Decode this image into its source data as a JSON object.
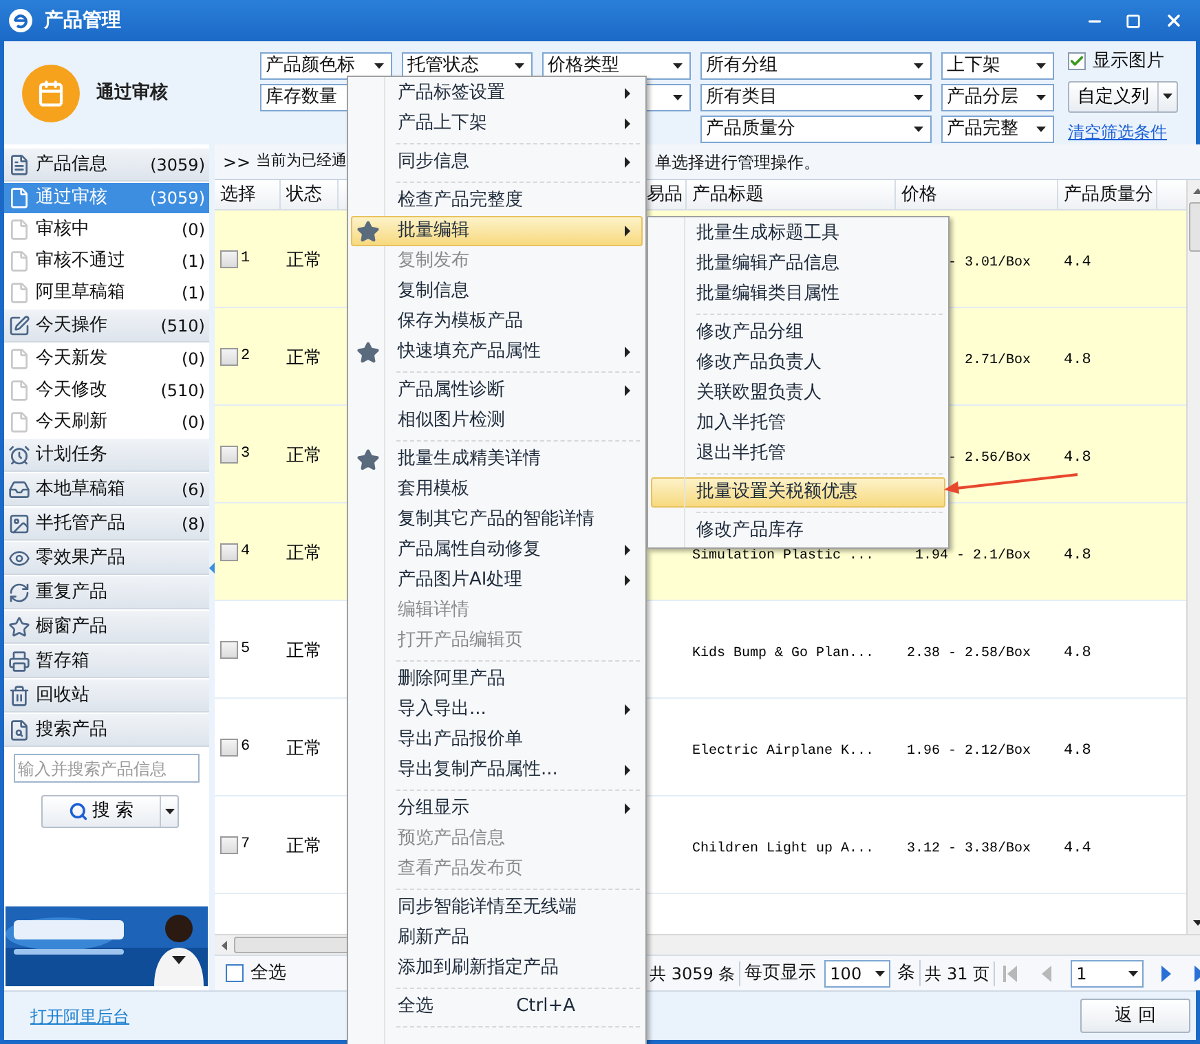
{
  "window": {
    "title": "产品管理"
  },
  "header": {
    "label": "通过审核"
  },
  "filter_rows": [
    [
      {
        "kind": "combo",
        "value": "产品颜色标"
      },
      {
        "kind": "combo",
        "value": "托管状态"
      },
      {
        "kind": "combo",
        "value": "价格类型"
      },
      {
        "kind": "combo",
        "value": "所有分组"
      },
      {
        "kind": "combo",
        "value": "上下架"
      }
    ],
    [
      {
        "kind": "combo",
        "value": "库存数量"
      },
      {
        "kind": "blank"
      },
      {
        "kind": "combo"
      },
      {
        "kind": "combo",
        "value": "所有类目"
      },
      {
        "kind": "combo",
        "value": "产品分层"
      }
    ],
    [
      {
        "kind": "blank"
      },
      {
        "kind": "blank"
      },
      {
        "kind": "blank"
      },
      {
        "kind": "combo",
        "value": "产品质量分"
      },
      {
        "kind": "combo",
        "value": "产品完整"
      }
    ]
  ],
  "show_images": {
    "label": "显示图片",
    "checked": true
  },
  "custom_columns": {
    "label": "自定义列"
  },
  "clear_filters": {
    "label": "清空筛选条件"
  },
  "sidebar": {
    "groups": [
      {
        "label": "产品信息",
        "count": "(3059)",
        "children": [
          {
            "label": "通过审核",
            "count": "(3059)",
            "selected": true
          },
          {
            "label": "审核中",
            "count": "(0)",
            "selected": false
          },
          {
            "label": "审核不通过",
            "count": "(1)",
            "selected": false
          },
          {
            "label": "阿里草稿箱",
            "count": "(1)",
            "selected": false
          }
        ]
      },
      {
        "label": "今天操作",
        "count": "(510)",
        "children": [
          {
            "label": "今天新发",
            "count": "(0)",
            "selected": false
          },
          {
            "label": "今天修改",
            "count": "(510)",
            "selected": false
          },
          {
            "label": "今天刷新",
            "count": "(0)",
            "selected": false
          }
        ]
      },
      {
        "label": "计划任务"
      },
      {
        "label": "本地草稿箱",
        "count": "(6)"
      },
      {
        "label": "半托管产品",
        "count": "(8)"
      },
      {
        "label": "零效果产品"
      },
      {
        "label": "重复产品"
      },
      {
        "label": "橱窗产品"
      },
      {
        "label": "暂存箱"
      },
      {
        "label": "回收站"
      },
      {
        "label": "搜索产品"
      }
    ],
    "search": {
      "placeholder": "输入并搜索产品信息",
      "button": "搜 索"
    }
  },
  "info_bar": {
    "lead": ">>",
    "text_before": "当前为已经通",
    "text_after": "单选择进行管理操作。"
  },
  "table": {
    "columns": [
      {
        "label": "选择"
      },
      {
        "label": "状态"
      },
      {},
      {
        "label": "易品"
      },
      {
        "label": "产品标题"
      },
      {
        "label": "价格"
      },
      {
        "label": "产品质量分"
      }
    ],
    "rows": [
      {
        "number": "1",
        "checked": false,
        "highlighted": true,
        "status": "正常",
        "price": "- 3.01/Box",
        "quality": "4.4"
      },
      {
        "number": "2",
        "checked": false,
        "highlighted": true,
        "status": "正常",
        "price": "2.71/Box",
        "quality": "4.8"
      },
      {
        "number": "3",
        "checked": false,
        "highlighted": true,
        "status": "正常",
        "price": "- 2.56/Box",
        "quality": "4.8"
      },
      {
        "number": "4",
        "checked": false,
        "highlighted": true,
        "status": "正常",
        "title": "Simulation Plastic ...",
        "price": "1.94 - 2.1/Box",
        "quality": "4.8"
      },
      {
        "number": "5",
        "checked": false,
        "highlighted": false,
        "status": "正常",
        "title": "Kids Bump & Go Plan...",
        "price": "2.38 - 2.58/Box",
        "quality": "4.8"
      },
      {
        "number": "6",
        "checked": false,
        "highlighted": false,
        "status": "正常",
        "title": "Electric Airplane K...",
        "price": "1.96 - 2.12/Box",
        "quality": "4.8"
      },
      {
        "number": "7",
        "checked": false,
        "highlighted": false,
        "status": "正常",
        "title": "Children Light up A...",
        "price": "3.12 - 3.38/Box",
        "quality": "4.4"
      }
    ]
  },
  "footer": {
    "select_all": {
      "label": "全选",
      "checked": false
    },
    "total": "共 3059 条",
    "per_page_label": "每页显示",
    "per_page": "100",
    "per_page_unit": "条",
    "pages": "共 31 页",
    "page": "1"
  },
  "bottom": {
    "link": "打开阿里后台",
    "back_button": "返 回"
  },
  "context_menu": {
    "items": [
      {
        "kind": "item",
        "label": "产品标签设置",
        "starred": false,
        "has_submenu": true,
        "disabled": false,
        "highlighted": false
      },
      {
        "kind": "item",
        "label": "产品上下架",
        "starred": false,
        "has_submenu": true,
        "disabled": false,
        "highlighted": false
      },
      {
        "kind": "separator"
      },
      {
        "kind": "item",
        "label": "同步信息",
        "starred": false,
        "has_submenu": true,
        "disabled": false,
        "highlighted": false
      },
      {
        "kind": "separator"
      },
      {
        "kind": "item",
        "label": "检查产品完整度",
        "starred": false,
        "has_submenu": false,
        "disabled": false,
        "highlighted": false
      },
      {
        "kind": "item",
        "label": "批量编辑",
        "starred": true,
        "has_submenu": true,
        "disabled": false,
        "highlighted": true
      },
      {
        "kind": "item",
        "label": "复制发布",
        "starred": false,
        "has_submenu": false,
        "disabled": true,
        "highlighted": false
      },
      {
        "kind": "item",
        "label": "复制信息",
        "starred": false,
        "has_submenu": false,
        "disabled": false,
        "highlighted": false
      },
      {
        "kind": "item",
        "label": "保存为模板产品",
        "starred": false,
        "has_submenu": false,
        "disabled": false,
        "highlighted": false
      },
      {
        "kind": "item",
        "label": "快速填充产品属性",
        "starred": true,
        "has_submenu": true,
        "disabled": false,
        "highlighted": false
      },
      {
        "kind": "separator"
      },
      {
        "kind": "item",
        "label": "产品属性诊断",
        "starred": false,
        "has_submenu": true,
        "disabled": false,
        "highlighted": false
      },
      {
        "kind": "item",
        "label": "相似图片检测",
        "starred": false,
        "has_submenu": false,
        "disabled": false,
        "highlighted": false
      },
      {
        "kind": "separator"
      },
      {
        "kind": "item",
        "label": "批量生成精美详情",
        "starred": true,
        "has_submenu": false,
        "disabled": false,
        "highlighted": false
      },
      {
        "kind": "item",
        "label": "套用模板",
        "starred": false,
        "has_submenu": false,
        "disabled": false,
        "highlighted": false
      },
      {
        "kind": "item",
        "label": "复制其它产品的智能详情",
        "starred": false,
        "has_submenu": false,
        "disabled": false,
        "highlighted": false
      },
      {
        "kind": "item",
        "label": "产品属性自动修复",
        "starred": false,
        "has_submenu": true,
        "disabled": false,
        "highlighted": false
      },
      {
        "kind": "item",
        "label": "产品图片AI处理",
        "starred": false,
        "has_submenu": true,
        "disabled": false,
        "highlighted": false
      },
      {
        "kind": "item",
        "label": "编辑详情",
        "starred": false,
        "has_submenu": false,
        "disabled": true,
        "highlighted": false
      },
      {
        "kind": "item",
        "label": "打开产品编辑页",
        "starred": false,
        "has_submenu": false,
        "disabled": true,
        "highlighted": false
      },
      {
        "kind": "separator"
      },
      {
        "kind": "item",
        "label": "删除阿里产品",
        "starred": false,
        "has_submenu": false,
        "disabled": false,
        "highlighted": false
      },
      {
        "kind": "item",
        "label": "导入导出...",
        "starred": false,
        "has_submenu": true,
        "disabled": false,
        "highlighted": false
      },
      {
        "kind": "item",
        "label": "导出产品报价单",
        "starred": false,
        "has_submenu": false,
        "disabled": false,
        "highlighted": false
      },
      {
        "kind": "item",
        "label": "导出复制产品属性...",
        "starred": false,
        "has_submenu": true,
        "disabled": false,
        "highlighted": false
      },
      {
        "kind": "separator"
      },
      {
        "kind": "item",
        "label": "分组显示",
        "starred": false,
        "has_submenu": true,
        "disabled": false,
        "highlighted": false
      },
      {
        "kind": "item",
        "label": "预览产品信息",
        "starred": false,
        "has_submenu": false,
        "disabled": true,
        "highlighted": false
      },
      {
        "kind": "item",
        "label": "查看产品发布页",
        "starred": false,
        "has_submenu": false,
        "disabled": true,
        "highlighted": false
      },
      {
        "kind": "separator"
      },
      {
        "kind": "item",
        "label": "同步智能详情至无线端",
        "starred": false,
        "has_submenu": false,
        "disabled": false,
        "highlighted": false
      },
      {
        "kind": "item",
        "label": "刷新产品",
        "starred": false,
        "has_submenu": false,
        "disabled": false,
        "highlighted": false
      },
      {
        "kind": "item",
        "label": "添加到刷新指定产品",
        "starred": false,
        "has_submenu": false,
        "disabled": false,
        "highlighted": false
      },
      {
        "kind": "separator"
      },
      {
        "kind": "item",
        "label": "全选",
        "shortcut": "Ctrl+A",
        "starred": false,
        "has_submenu": false,
        "disabled": false,
        "highlighted": false
      },
      {
        "kind": "separator"
      }
    ]
  },
  "submenu": {
    "items": [
      {
        "kind": "item",
        "label": "批量生成标题工具",
        "highlighted": false
      },
      {
        "kind": "item",
        "label": "批量编辑产品信息",
        "highlighted": false
      },
      {
        "kind": "item",
        "label": "批量编辑类目属性",
        "highlighted": false
      },
      {
        "kind": "separator"
      },
      {
        "kind": "item",
        "label": "修改产品分组",
        "highlighted": false
      },
      {
        "kind": "item",
        "label": "修改产品负责人",
        "highlighted": false
      },
      {
        "kind": "item",
        "label": "关联欧盟负责人",
        "highlighted": false
      },
      {
        "kind": "item",
        "label": "加入半托管",
        "highlighted": false
      },
      {
        "kind": "item",
        "label": "退出半托管",
        "highlighted": false
      },
      {
        "kind": "separator"
      },
      {
        "kind": "item",
        "label": "批量设置关税额优惠",
        "highlighted": true
      },
      {
        "kind": "separator"
      },
      {
        "kind": "item",
        "label": "修改产品库存",
        "highlighted": false
      }
    ]
  }
}
